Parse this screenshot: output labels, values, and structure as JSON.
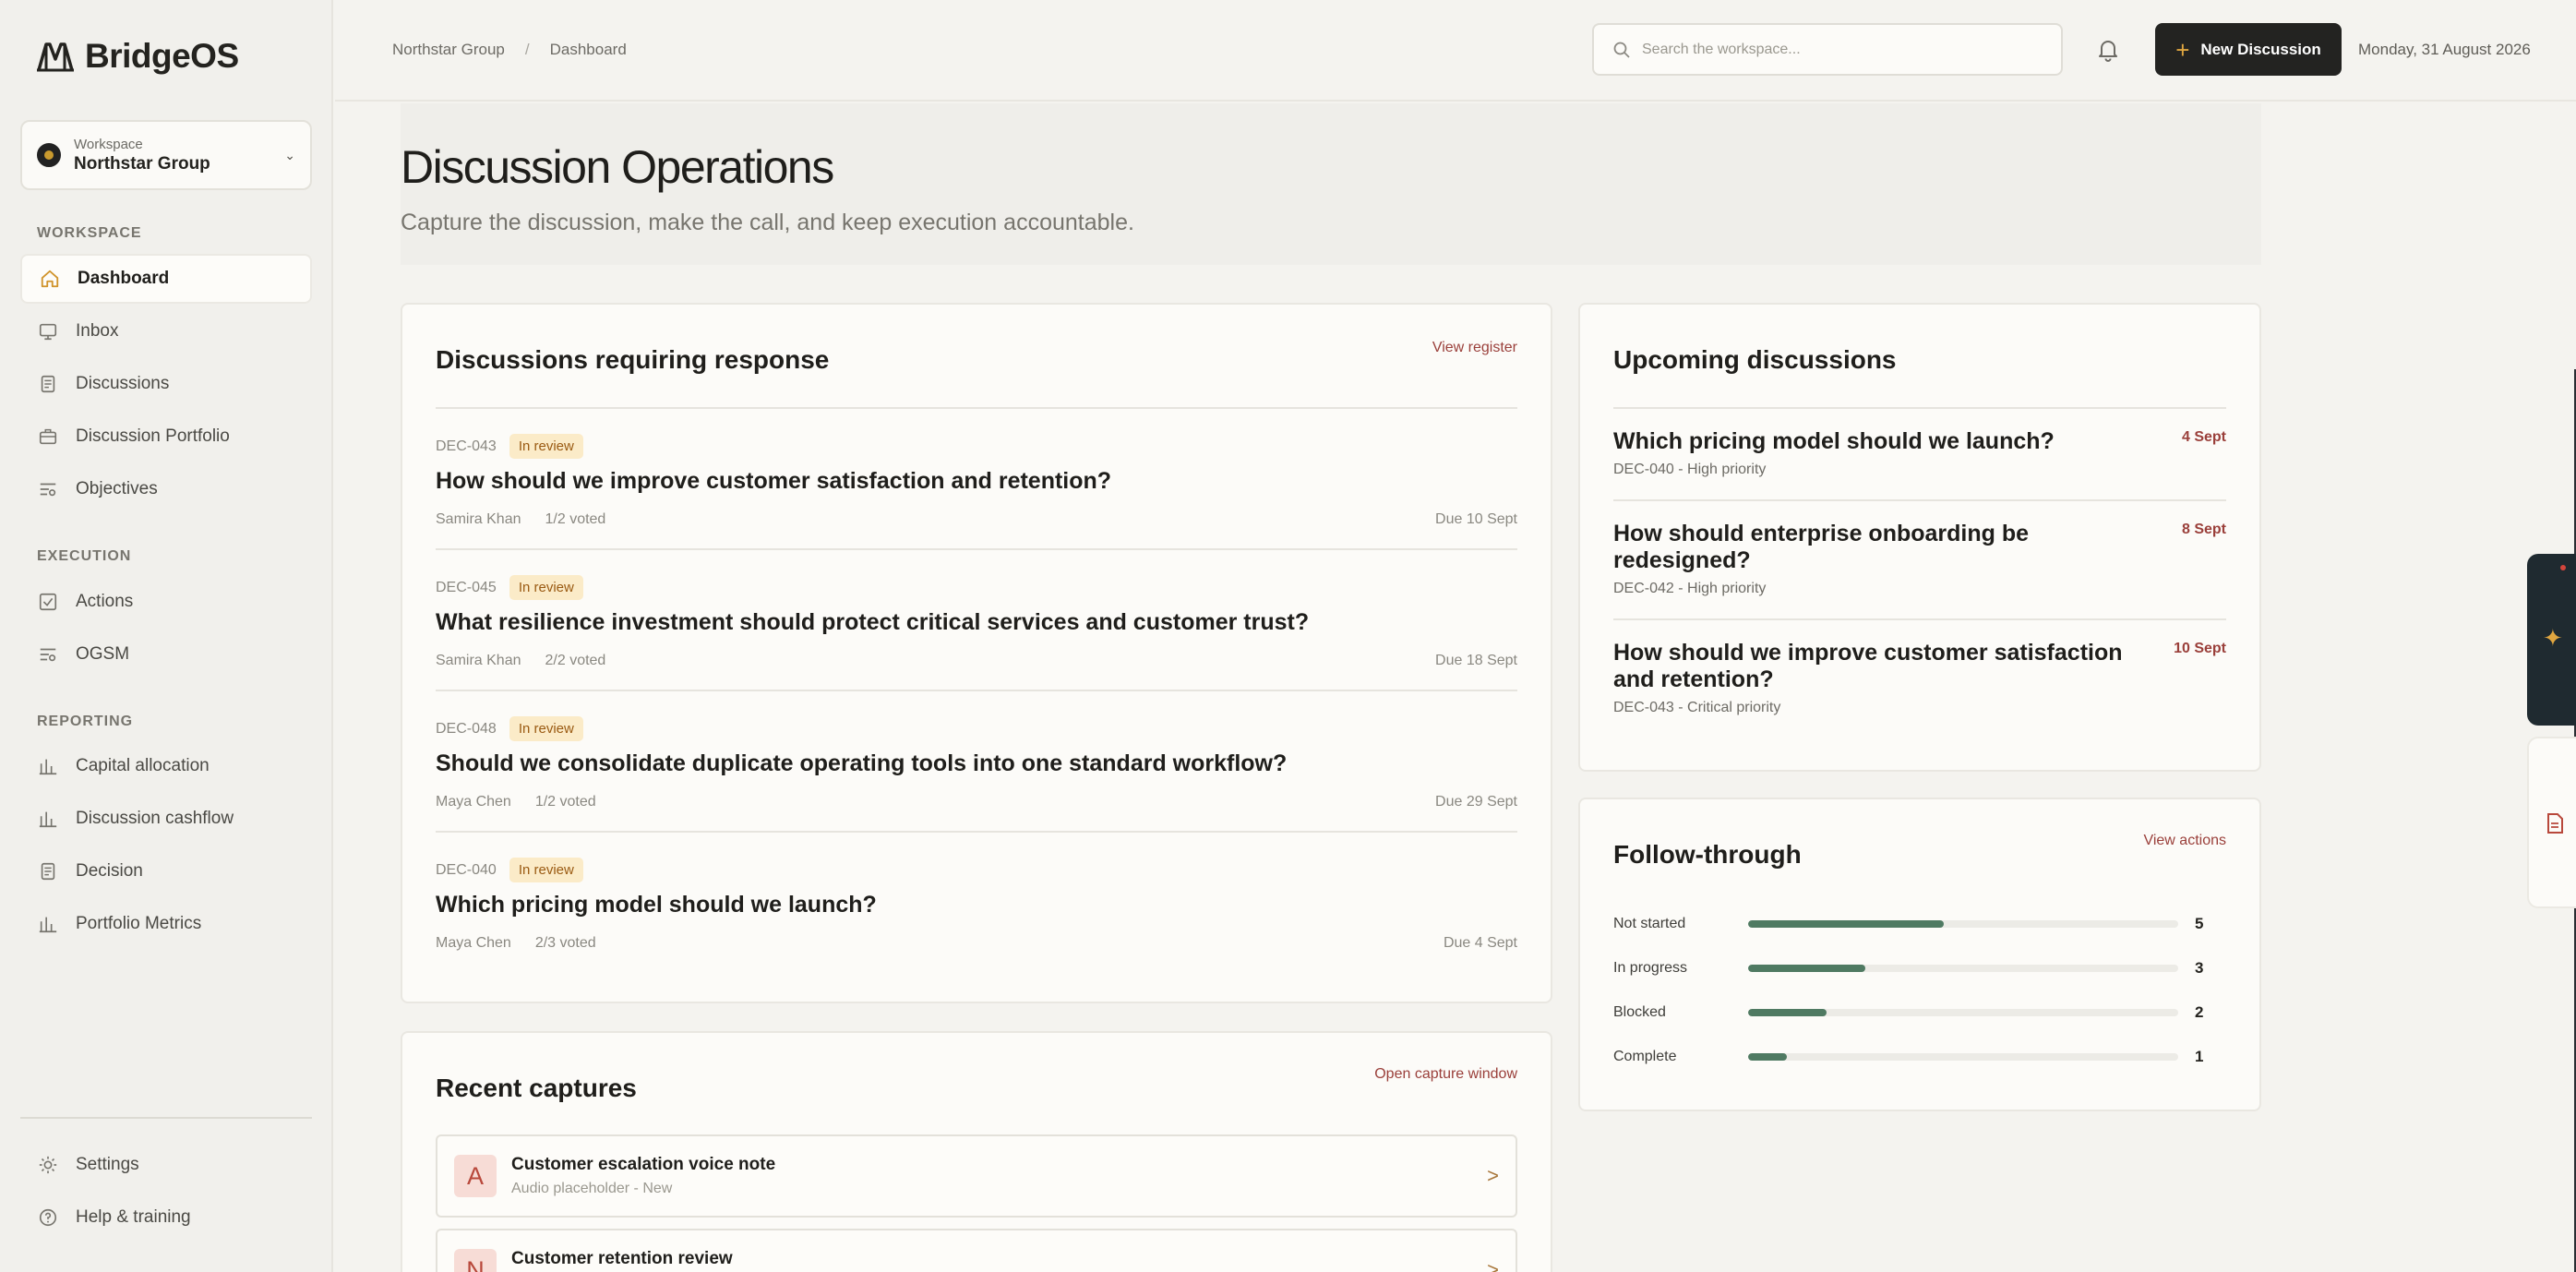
{
  "brand": {
    "name": "BridgeOS"
  },
  "workspace": {
    "label": "Workspace",
    "name": "Northstar Group"
  },
  "nav": {
    "sections": [
      {
        "title": "WORKSPACE",
        "items": [
          "Dashboard",
          "Inbox",
          "Discussions",
          "Discussion Portfolio",
          "Objectives"
        ]
      },
      {
        "title": "EXECUTION",
        "items": [
          "Actions",
          "OGSM"
        ]
      },
      {
        "title": "REPORTING",
        "items": [
          "Capital allocation",
          "Discussion cashflow",
          "Decision",
          "Portfolio Metrics"
        ]
      }
    ],
    "footer": [
      "Settings",
      "Help & training"
    ]
  },
  "topbar": {
    "breadcrumbs": [
      "Northstar Group",
      "Dashboard"
    ],
    "separator": "/",
    "search_placeholder": "Search the workspace...",
    "new_button": "New Discussion",
    "date": "Monday, 31 August 2026"
  },
  "page": {
    "title": "Discussion Operations",
    "subtitle": "Capture the discussion, make the call, and keep execution accountable."
  },
  "requiring_response": {
    "title": "Discussions requiring response",
    "link": "View register",
    "items": [
      {
        "id": "DEC-043",
        "status": "In review",
        "title": "How should we improve customer satisfaction and retention?",
        "owner": "Samira Khan",
        "votes": "1/2 voted",
        "due": "Due 10 Sept"
      },
      {
        "id": "DEC-045",
        "status": "In review",
        "title": "What resilience investment should protect critical services and customer trust?",
        "owner": "Samira Khan",
        "votes": "2/2 voted",
        "due": "Due 18 Sept"
      },
      {
        "id": "DEC-048",
        "status": "In review",
        "title": "Should we consolidate duplicate operating tools into one standard workflow?",
        "owner": "Maya Chen",
        "votes": "1/2 voted",
        "due": "Due 29 Sept"
      },
      {
        "id": "DEC-040",
        "status": "In review",
        "title": "Which pricing model should we launch?",
        "owner": "Maya Chen",
        "votes": "2/3 voted",
        "due": "Due 4 Sept"
      }
    ]
  },
  "upcoming": {
    "title": "Upcoming discussions",
    "items": [
      {
        "title": "Which pricing model should we launch?",
        "meta": "DEC-040 - High priority",
        "date": "4 Sept"
      },
      {
        "title": "How should enterprise onboarding be redesigned?",
        "meta": "DEC-042 - High priority",
        "date": "8 Sept"
      },
      {
        "title": "How should we improve customer satisfaction and retention?",
        "meta": "DEC-043 - Critical priority",
        "date": "10 Sept"
      }
    ]
  },
  "follow_through": {
    "title": "Follow-through",
    "link": "View actions",
    "max": 11,
    "rows": [
      {
        "label": "Not started",
        "count": 5
      },
      {
        "label": "In progress",
        "count": 3
      },
      {
        "label": "Blocked",
        "count": 2
      },
      {
        "label": "Complete",
        "count": 1
      }
    ]
  },
  "captures": {
    "title": "Recent captures",
    "link": "Open capture window",
    "items": [
      {
        "initial": "A",
        "title": "Customer escalation voice note",
        "sub": "Audio placeholder - New",
        "arrow": ">"
      },
      {
        "initial": "N",
        "title": "Customer retention review",
        "sub": "",
        "arrow": ">"
      }
    ]
  },
  "colors": {
    "accent": "#e0a640",
    "link": "#9a3f3a",
    "progress": "#4f7a62",
    "badge_bg": "#fbebc8",
    "badge_text": "#9a5a12",
    "dark": "#232321"
  }
}
